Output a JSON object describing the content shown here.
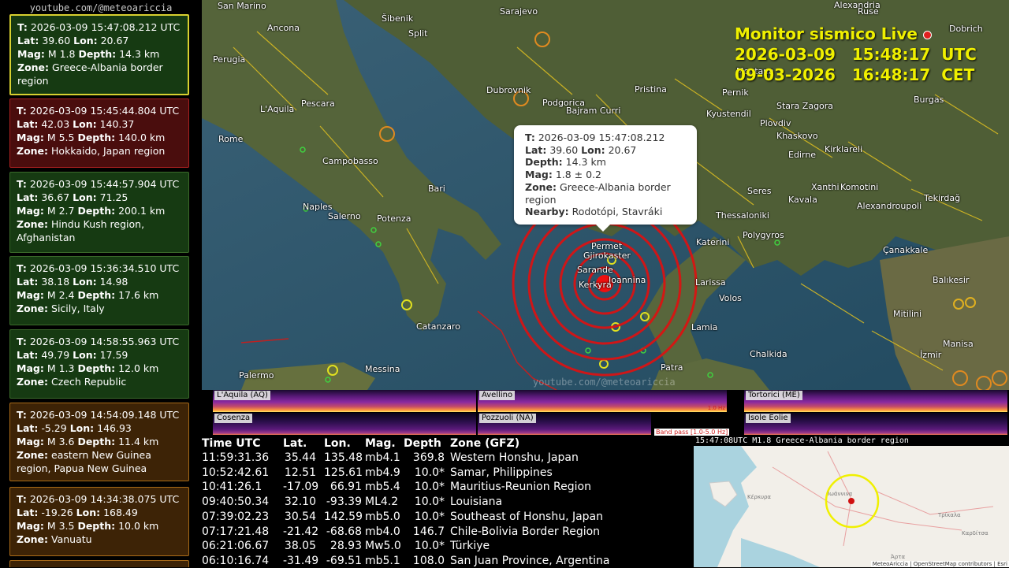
{
  "channel": "youtube.com/@meteoariccia",
  "events": [
    {
      "t": "2026-03-09  15:47:08.212 UTC",
      "lat": "39.60",
      "lon": "20.67",
      "mag": "M 1.8",
      "depth": "14.3 km",
      "zone": "Greece-Albania border region",
      "color": "green",
      "selected": true
    },
    {
      "t": "2026-03-09  15:45:44.804 UTC",
      "lat": "42.03",
      "lon": "140.37",
      "mag": "M 5.5",
      "depth": "140.0 km",
      "zone": "Hokkaido, Japan region",
      "color": "red"
    },
    {
      "t": "2026-03-09  15:44:57.904 UTC",
      "lat": "36.67",
      "lon": "71.25",
      "mag": "M 2.7",
      "depth": "200.1 km",
      "zone": "Hindu Kush region, Afghanistan",
      "color": "green"
    },
    {
      "t": "2026-03-09  15:36:34.510 UTC",
      "lat": "38.18",
      "lon": "14.98",
      "mag": "M 2.4",
      "depth": "17.6 km",
      "zone": "Sicily, Italy",
      "color": "green"
    },
    {
      "t": "2026-03-09  14:58:55.963 UTC",
      "lat": "49.79",
      "lon": "17.59",
      "mag": "M 1.3",
      "depth": "12.0 km",
      "zone": "Czech Republic",
      "color": "green"
    },
    {
      "t": "2026-03-09  14:54:09.148 UTC",
      "lat": "-5.29",
      "lon": "146.93",
      "mag": "M 3.6",
      "depth": "11.4 km",
      "zone": "eastern New Guinea region, Papua New Guinea",
      "color": "orange"
    },
    {
      "t": "2026-03-09  14:34:38.075 UTC",
      "lat": "-19.26",
      "lon": "168.49",
      "mag": "M 3.5",
      "depth": "10.0 km",
      "zone": "Vanuatu",
      "color": "orange"
    }
  ],
  "labels": {
    "t": "T:",
    "lat": "Lat:",
    "lon": "Lon:",
    "mag": "Mag:",
    "depth": "Depth:",
    "zone": "Zone:",
    "nearby": "Nearby:"
  },
  "monitor": {
    "title": "Monitor sismico Live",
    "utc": "2026-03-09   15:48:17  UTC",
    "cet": "09-03-2026   16:48:17  CET"
  },
  "popup": {
    "t": "2026-03-09  15:47:08.212",
    "lat": "39.60",
    "lon": "20.67",
    "depth": "14.3 km",
    "mag": "1.8 ± 0.2",
    "zone": "Greece-Albania border region",
    "nearby": "Rodotópi, Stavráki"
  },
  "cities": [
    {
      "name": "San Marino"
    },
    {
      "name": "Ancona"
    },
    {
      "name": "Šibenik"
    },
    {
      "name": "Split"
    },
    {
      "name": "Sarajevo"
    },
    {
      "name": "Perugia"
    },
    {
      "name": "Pescara"
    },
    {
      "name": "L'Aquila"
    },
    {
      "name": "Dubrovnik"
    },
    {
      "name": "Podgorica"
    },
    {
      "name": "Pristina"
    },
    {
      "name": "Bajram Curri"
    },
    {
      "name": "Rome"
    },
    {
      "name": "Campobasso"
    },
    {
      "name": "Bari"
    },
    {
      "name": "Naples"
    },
    {
      "name": "Salerno"
    },
    {
      "name": "Potenza"
    },
    {
      "name": "Catanzaro"
    },
    {
      "name": "Palermo"
    },
    {
      "name": "Messina"
    },
    {
      "name": "Kyustendil"
    },
    {
      "name": "Plovdiv"
    },
    {
      "name": "Stara Zagora"
    },
    {
      "name": "Burgas"
    },
    {
      "name": "Khaskovo"
    },
    {
      "name": "Edirne"
    },
    {
      "name": "Kirklareli"
    },
    {
      "name": "Xanthi"
    },
    {
      "name": "Komotini"
    },
    {
      "name": "Tekirdağ"
    },
    {
      "name": "Seres"
    },
    {
      "name": "Kavala"
    },
    {
      "name": "Alexandroupoli"
    },
    {
      "name": "Thessaloniki"
    },
    {
      "name": "Katerini"
    },
    {
      "name": "Polygyros"
    },
    {
      "name": "Çanakkale"
    },
    {
      "name": "Larissa"
    },
    {
      "name": "Volos"
    },
    {
      "name": "Balıkesir"
    },
    {
      "name": "Lamia"
    },
    {
      "name": "Mitilini"
    },
    {
      "name": "Chalkida"
    },
    {
      "name": "Manisa"
    },
    {
      "name": "İzmir"
    },
    {
      "name": "Patra"
    },
    {
      "name": "Pernik"
    },
    {
      "name": "Montana"
    },
    {
      "name": "Dobrich"
    },
    {
      "name": "Alexandria"
    },
    {
      "name": "Ruse"
    },
    {
      "name": "Ioannina"
    },
    {
      "name": "Permet"
    },
    {
      "name": "Gjirokaster"
    },
    {
      "name": "Sarande"
    },
    {
      "name": "Kerkyra"
    }
  ],
  "watermark": "youtube.com/@meteoariccia",
  "stations": [
    {
      "name": "L'Aquila (AQ)"
    },
    {
      "name": "Avellino"
    },
    {
      "name": "Tortorici (ME)"
    },
    {
      "name": "Cosenza"
    },
    {
      "name": "Pozzuoli (NA)"
    },
    {
      "name": "Isole Eolie"
    }
  ],
  "bandpass": "Band pass [1.0-5.0 Hz]",
  "freq_label": "1.0 Hz",
  "table": {
    "headers": [
      "Time UTC",
      "Lat.",
      "Lon.",
      "Mag.",
      "Depth",
      "Zone (GFZ)"
    ],
    "rows": [
      [
        "11:59:31.36",
        "35.44",
        "135.48",
        "mb4.1",
        "369.8",
        "Western Honshu, Japan"
      ],
      [
        "10:52:42.61",
        "12.51",
        "125.61",
        "mb4.9",
        "10.0*",
        "Samar, Philippines"
      ],
      [
        "10:41:26.1",
        "-17.09",
        "66.91",
        "mb5.4",
        "10.0*",
        "Mauritius-Reunion Region"
      ],
      [
        "09:40:50.34",
        "32.10",
        "-93.39",
        "ML4.2",
        "10.0*",
        "Louisiana"
      ],
      [
        "07:39:02.23",
        "30.54",
        "142.59",
        "mb5.0",
        "10.0*",
        "Southeast of Honshu, Japan"
      ],
      [
        "07:17:21.48",
        "-21.42",
        "-68.68",
        "mb4.0",
        "146.7",
        "Chile-Bolivia Border Region"
      ],
      [
        "06:21:06.67",
        "38.05",
        "28.93",
        "Mw5.0",
        "10.0*",
        "Türkiye"
      ],
      [
        "06:10:16.74",
        "-31.49",
        "-69.51",
        "mb5.1",
        "108.0",
        "San Juan Province, Argentina"
      ]
    ]
  },
  "minimap": {
    "title": "15:47:08UTC   M1.8   Greece-Albania border region",
    "attribution": "MeteoAriccia | OpenStreetMap contributors | Esri",
    "cities": [
      {
        "name": "Κέρκυρα"
      },
      {
        "name": "Ιωάννινα"
      },
      {
        "name": "Τρίκαλα"
      },
      {
        "name": "Άρτα"
      },
      {
        "name": "Καρδίτσα"
      }
    ]
  },
  "colors": {
    "green": "#163a12",
    "red": "#4a0d0d",
    "orange": "#3d2306",
    "accent": "#f0f000",
    "rings": "#e01010"
  }
}
